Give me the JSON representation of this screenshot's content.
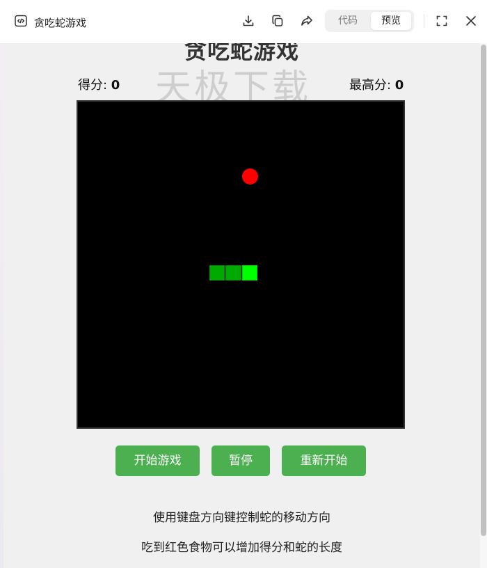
{
  "window": {
    "title": "贪吃蛇游戏",
    "icons": [
      "code-file-icon",
      "download-icon",
      "copy-icon",
      "share-icon",
      "fullscreen-icon",
      "close-icon"
    ],
    "segmented": {
      "code_label": "代码",
      "preview_label": "预览",
      "selected": "预览"
    }
  },
  "game": {
    "title": "贪吃蛇游戏",
    "watermark": "天极下载",
    "score_label": "得分: ",
    "score_value": "0",
    "high_score_label": "最高分: ",
    "high_score_value": "0",
    "grid_size": 20,
    "food": {
      "col": 10,
      "row": 4
    },
    "snake": [
      {
        "col": 10,
        "row": 10,
        "head": true
      },
      {
        "col": 9,
        "row": 10
      },
      {
        "col": 8,
        "row": 10
      }
    ],
    "colors": {
      "board": "#000000",
      "food": "#ff0000",
      "head": "#00ff00",
      "body": "#00aa00",
      "button": "#4caf50"
    }
  },
  "buttons": {
    "start": "开始游戏",
    "pause": "暂停",
    "restart": "重新开始"
  },
  "instructions": {
    "line1": "使用键盘方向键控制蛇的移动方向",
    "line2": "吃到红色食物可以增加得分和蛇的长度"
  }
}
